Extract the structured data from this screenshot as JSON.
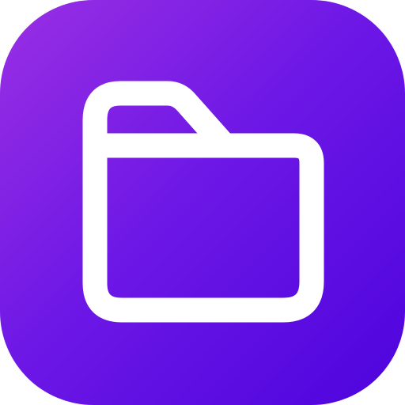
{
  "app_icon": {
    "icon": "folder-icon",
    "colors": {
      "gradient_start": "#9a2fe3",
      "gradient_mid": "#6c17e6",
      "gradient_end": "#4d04dd",
      "glyph": "#ffffff"
    }
  }
}
